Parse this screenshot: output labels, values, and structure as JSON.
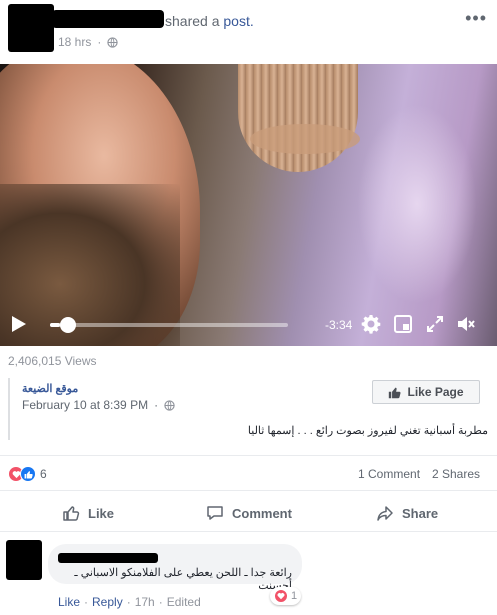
{
  "post": {
    "shared_text_prefix": "shared a",
    "shared_text_link": "post.",
    "time": "18 hrs",
    "more": "•••"
  },
  "video": {
    "time_remaining": "-3:34",
    "progress": 0.04
  },
  "views": "2,406,015 Views",
  "shared_post": {
    "page_name": "موقع الضيعة",
    "date": "February 10 at 8:39 PM",
    "like_page_label": "Like Page",
    "caption": "مطربة أسبانية تغني لفيروز بصوت رائع . . . إسمها ثاليا"
  },
  "reactions": {
    "count": "6",
    "comments": "1 Comment",
    "shares": "2 Shares"
  },
  "actions": {
    "like": "Like",
    "comment": "Comment",
    "share": "Share"
  },
  "comment": {
    "text": "رائعة جدا ـ اللحن يعطي على الفلامنكو الاسباني ـ أحسنت",
    "like": "Like",
    "reply": "Reply",
    "time": "17h",
    "edited": "Edited",
    "reaction_count": "1",
    "sep": "·"
  },
  "colors": {
    "link": "#385898",
    "love": "#f25268",
    "like": "#1877f2"
  }
}
